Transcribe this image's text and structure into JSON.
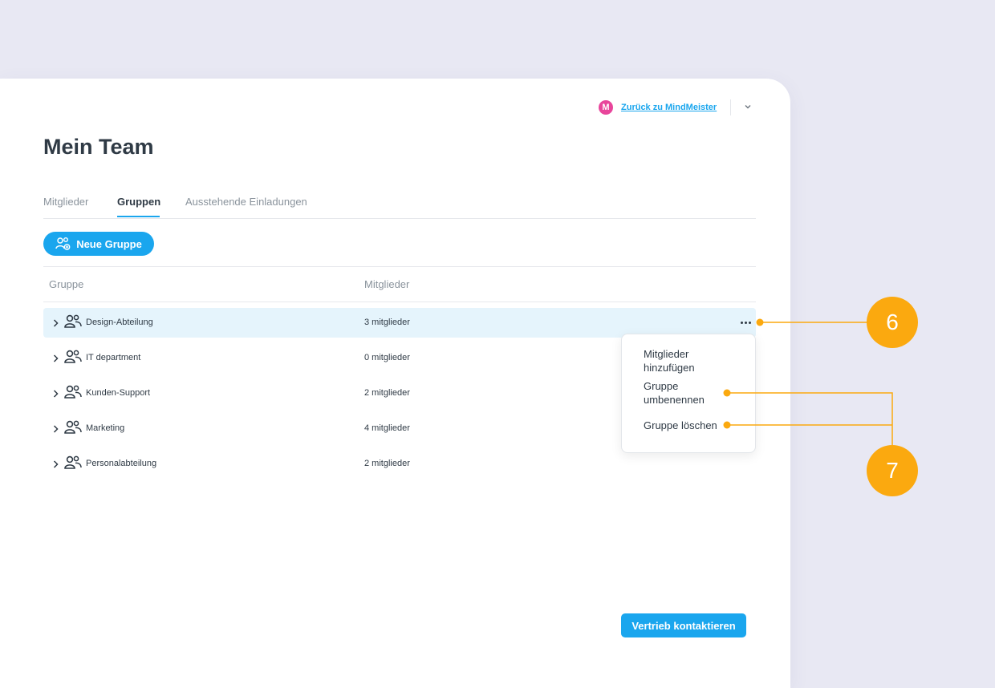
{
  "header": {
    "logo_letter": "M",
    "back_link": "Zurück zu MindMeister"
  },
  "page_title": "Mein Team",
  "tabs": [
    {
      "label": "Mitglieder",
      "active": false
    },
    {
      "label": "Gruppen",
      "active": true
    },
    {
      "label": "Ausstehende Einladungen",
      "active": false
    }
  ],
  "new_group_button": "Neue Gruppe",
  "table": {
    "columns": [
      "Gruppe",
      "Mitglieder"
    ],
    "rows": [
      {
        "name": "Design-Abteilung",
        "members": "3 mitglieder",
        "selected": true
      },
      {
        "name": "IT department",
        "members": "0 mitglieder",
        "selected": false
      },
      {
        "name": "Kunden-Support",
        "members": "2 mitglieder",
        "selected": false
      },
      {
        "name": "Marketing",
        "members": "4 mitglieder",
        "selected": false
      },
      {
        "name": "Personalabteilung",
        "members": "2 mitglieder",
        "selected": false
      }
    ]
  },
  "context_menu": [
    "Mitglieder hinzufügen",
    "Gruppe umbenennen",
    "Gruppe löschen"
  ],
  "contact_button": "Vertrieb kontaktieren",
  "callouts": [
    "6",
    "7"
  ],
  "colors": {
    "accent": "#1aa6ee",
    "callout": "#fba90f",
    "logo": "#e8459b",
    "selected_row": "#e5f4fc",
    "background": "#e8e8f3"
  },
  "icons": [
    "mindmeister-logo",
    "chevron-down-icon",
    "add-group-icon",
    "chevron-right-icon",
    "group-icon",
    "more-icon"
  ]
}
